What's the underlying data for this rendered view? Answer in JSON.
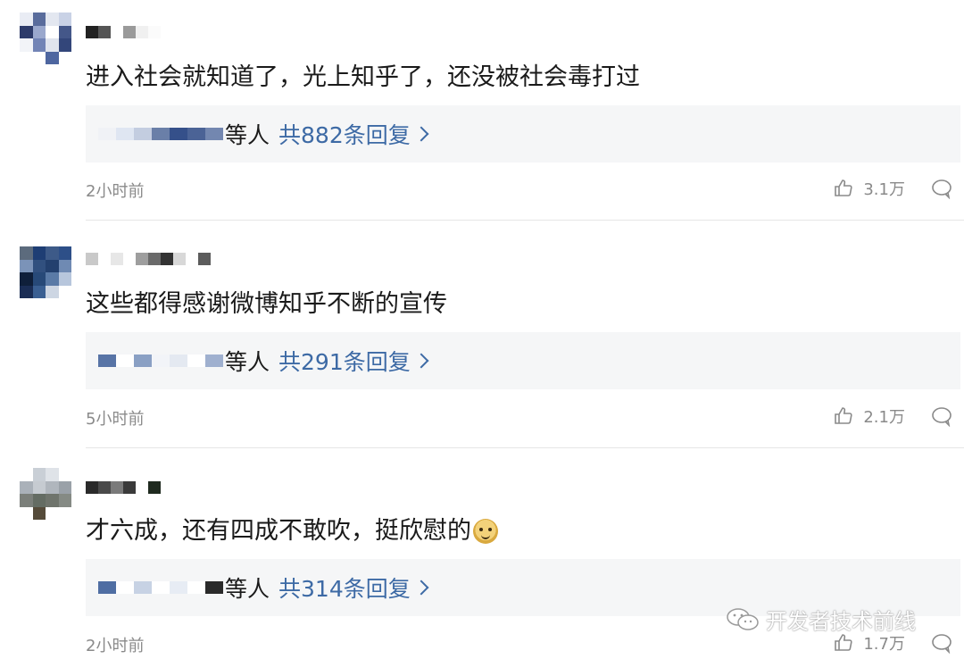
{
  "comments": [
    {
      "text": "进入社会就知道了，光上知乎了，还没被社会毒打过",
      "reply_suffix": "等人",
      "reply_link": "共882条回复",
      "time": "2小时前",
      "likes": "3.1万",
      "avatar_colors": [
        "#e9ecf4",
        "#596c9c",
        "#e3e7f0",
        "#c9d2e6",
        "#2d3b6a",
        "#9aa8cd",
        "#ffffff",
        "#445789",
        "#f2f4f8",
        "#7284b6",
        "#e0e4ee",
        "#33467a",
        "#ffffff",
        "#ffffff",
        "#4e66a0",
        "#ffffff"
      ],
      "username_blocks": [
        "#222222",
        "#555555",
        "#ffffff",
        "#9a9a9a",
        "#f0f0f0",
        "#fbfbfb"
      ],
      "reply_blocks": [
        "#f0f2f6",
        "#dfe6f2",
        "#c3cde0",
        "#6a7fa8",
        "#35508a",
        "#4b6396",
        "#7387b0"
      ]
    },
    {
      "text": "这些都得感谢微博知乎不断的宣传",
      "reply_suffix": "等人",
      "reply_link": "共291条回复",
      "time": "5小时前",
      "likes": "2.1万",
      "avatar_colors": [
        "#5c6b7d",
        "#1e3e74",
        "#3d5a88",
        "#2d4f88",
        "#7b93b8",
        "#31507f",
        "#23406e",
        "#6f8ab3",
        "#0f1f3a",
        "#274978",
        "#5a7aa6",
        "#b7c6dc",
        "#1a2d55",
        "#3a5f92",
        "#cdd6e3",
        "#ffffff"
      ],
      "username_blocks": [
        "#c9c9c9",
        "#ffffff",
        "#e7e7e7",
        "#ffffff",
        "#9e9e9e",
        "#6a6a6a",
        "#333333",
        "#d8d8d8",
        "#ffffff",
        "#5c5c5c"
      ],
      "reply_blocks": [
        "#5874a6",
        "#ffffff",
        "#8aa0c4",
        "#f2f4f8",
        "#e4e9f1",
        "#ffffff",
        "#9fb0cf"
      ]
    },
    {
      "text": "才六成，还有四成不敢吹，挺欣慰的",
      "reply_suffix": "等人",
      "reply_link": "共314条回复",
      "time": "2小时前",
      "likes": "1.7万",
      "avatar_colors": [
        "#ffffff",
        "#c9cfd6",
        "#dfe3e8",
        "#ffffff",
        "#aab1b9",
        "#c6cbd1",
        "#b0b6bd",
        "#9aa1a8",
        "#7b7f7a",
        "#646c63",
        "#6f746c",
        "#858a84",
        "#ffffff",
        "#554b3a",
        "#ffffff",
        "#ffffff"
      ],
      "username_blocks": [
        "#2a2a2a",
        "#4a4a4a",
        "#7a7a7a",
        "#3a3a3a",
        "#ffffff",
        "#1f2a1f"
      ],
      "reply_blocks": [
        "#4f6ea3",
        "#ffffff",
        "#c7d2e4",
        "#ffffff",
        "#e7ecf4",
        "#ffffff",
        "#2a2a2a"
      ]
    }
  ],
  "watermark": {
    "text": "开发者技术前线"
  },
  "colors": {
    "link": "#3d6aa5",
    "reply_bg": "#f5f6f7",
    "meta": "#8a8a8a"
  }
}
